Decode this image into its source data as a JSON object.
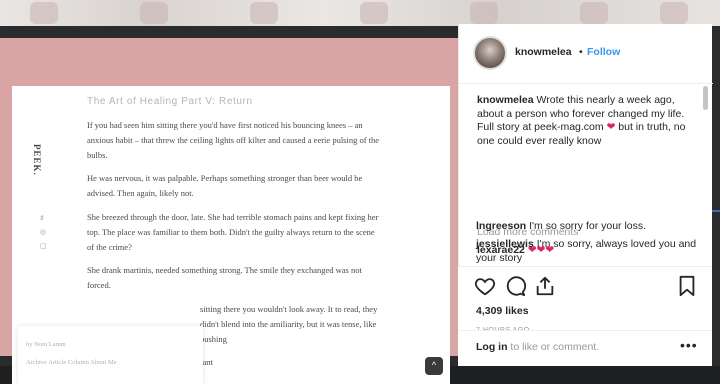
{
  "article": {
    "brand": "PEEK.",
    "title": "The Art of Healing Part V: Return",
    "paragraphs": [
      "If you had seen him sitting there you'd have first noticed his bouncing knees – an anxious habit – that threw the ceiling lights off kilter and caused a eerie pulsing of the bulbs.",
      "He was nervous, it was palpable. Perhaps something stronger than beer would be advised. Then again, likely not.",
      "She breezed through the door, late. She had terrible stomach pains and kept fixing her top. The place was familiar to them both. Didn't the guilty always return to the scene of the crime?",
      "She drank martinis, needed something strong. The smile they exchanged was not forced.",
      "sitting there you wouldn't look away. It to read, they didn't blend into the amiliarity, but it was tense, like pushing",
      "through water – smooth and resistant"
    ],
    "byline": "by Noni Lamm",
    "byline_links": "Archive  Article  Column  About Me",
    "side_icons": [
      "♯",
      "◎",
      "▢"
    ],
    "up_button": "^"
  },
  "post": {
    "username": "knowmelea",
    "follow_label": "Follow",
    "separator": "•",
    "caption_user": "knowmelea",
    "caption_text": "Wrote this nearly a week ago, about a person who forever changed my life. Full story at peek-mag.com",
    "caption_heart": "❤",
    "caption_tail": "but in truth, no one could ever really know",
    "load_more": "Load more comments",
    "comments": [
      {
        "user": "lexarae22",
        "text": "❤❤❤"
      },
      {
        "user": "lngreeson",
        "text": "I'm so sorry for your loss."
      },
      {
        "user": "jessiellewis",
        "text": "I'm so sorry, always loved you and your story"
      }
    ],
    "likes": "4,309 likes",
    "time_ago": "7 HOURS AGO",
    "login_link": "Log in",
    "login_tail": "to like or comment.",
    "more_label": "•••",
    "icons": [
      "heart-icon",
      "comment-icon",
      "share-icon",
      "bookmark-icon"
    ]
  }
}
